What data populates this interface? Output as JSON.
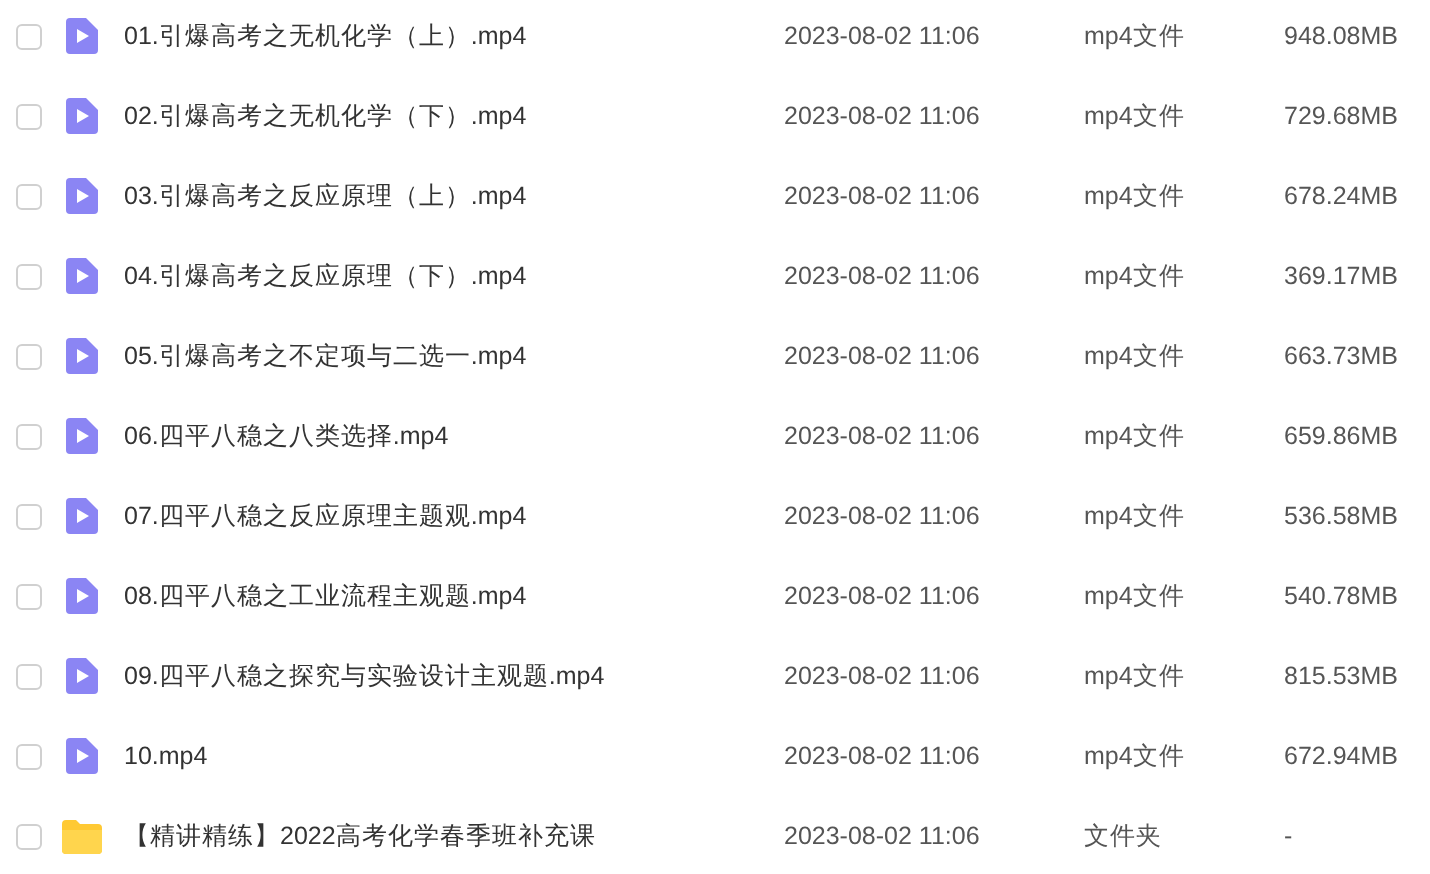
{
  "files": [
    {
      "kind": "video",
      "checked": false,
      "name": "01.引爆高考之无机化学（上）.mp4",
      "date": "2023-08-02 11:06",
      "type": "mp4文件",
      "size": "948.08MB"
    },
    {
      "kind": "video",
      "checked": false,
      "name": "02.引爆高考之无机化学（下）.mp4",
      "date": "2023-08-02 11:06",
      "type": "mp4文件",
      "size": "729.68MB"
    },
    {
      "kind": "video",
      "checked": false,
      "name": "03.引爆高考之反应原理（上）.mp4",
      "date": "2023-08-02 11:06",
      "type": "mp4文件",
      "size": "678.24MB"
    },
    {
      "kind": "video",
      "checked": false,
      "name": "04.引爆高考之反应原理（下）.mp4",
      "date": "2023-08-02 11:06",
      "type": "mp4文件",
      "size": "369.17MB"
    },
    {
      "kind": "video",
      "checked": false,
      "name": "05.引爆高考之不定项与二选一.mp4",
      "date": "2023-08-02 11:06",
      "type": "mp4文件",
      "size": "663.73MB"
    },
    {
      "kind": "video",
      "checked": false,
      "name": "06.四平八稳之八类选择.mp4",
      "date": "2023-08-02 11:06",
      "type": "mp4文件",
      "size": "659.86MB"
    },
    {
      "kind": "video",
      "checked": false,
      "name": "07.四平八稳之反应原理主题观.mp4",
      "date": "2023-08-02 11:06",
      "type": "mp4文件",
      "size": "536.58MB"
    },
    {
      "kind": "video",
      "checked": false,
      "name": "08.四平八稳之工业流程主观题.mp4",
      "date": "2023-08-02 11:06",
      "type": "mp4文件",
      "size": "540.78MB"
    },
    {
      "kind": "video",
      "checked": false,
      "name": "09.四平八稳之探究与实验设计主观题.mp4",
      "date": "2023-08-02 11:06",
      "type": "mp4文件",
      "size": "815.53MB"
    },
    {
      "kind": "video",
      "checked": false,
      "name": "10.mp4",
      "date": "2023-08-02 11:06",
      "type": "mp4文件",
      "size": "672.94MB"
    },
    {
      "kind": "folder",
      "checked": false,
      "name": "【精讲精练】2022高考化学春季班补充课",
      "date": "2023-08-02 11:06",
      "type": "文件夹",
      "size": "-"
    }
  ]
}
